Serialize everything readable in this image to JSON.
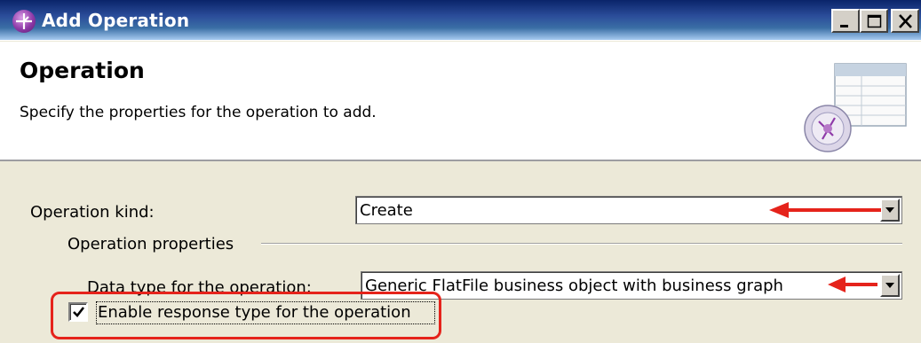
{
  "window": {
    "title": "Add Operation",
    "controls": [
      "minimize",
      "maximize",
      "close"
    ]
  },
  "header": {
    "title": "Operation",
    "description": "Specify the properties for the operation to add.",
    "icon": "operation-table-icon"
  },
  "form": {
    "operation_kind": {
      "label": "Operation kind:",
      "value": "Create"
    },
    "group": {
      "label": "Operation properties"
    },
    "data_type": {
      "label": "Data type for the operation:",
      "value": "Generic FlatFile business object with business graph"
    },
    "enable_response": {
      "label": "Enable response type for the operation",
      "checked": true
    }
  },
  "annotations": {
    "color": "#e5231b",
    "arrows": [
      "operation-kind-arrow",
      "data-type-arrow"
    ],
    "highlight": "enable-response-highlight"
  }
}
